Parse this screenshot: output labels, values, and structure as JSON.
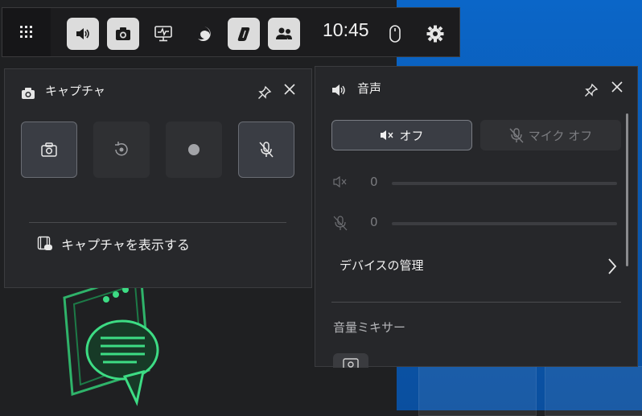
{
  "topbar": {
    "time": "10:45",
    "buttons": [
      {
        "name": "widget-menu-icon",
        "active": false
      },
      {
        "name": "audio-widget-icon",
        "active": true
      },
      {
        "name": "capture-widget-icon",
        "active": true
      },
      {
        "name": "performance-widget-icon",
        "active": false
      },
      {
        "name": "edge-icon",
        "active": false
      },
      {
        "name": "copilot-icon",
        "active": true
      },
      {
        "name": "xbox-social-icon",
        "active": true
      },
      {
        "name": "mouse-icon",
        "active": false
      },
      {
        "name": "settings-icon",
        "active": false
      }
    ]
  },
  "capture": {
    "title": "キャプチャ",
    "show_captures": "キャプチャを表示する",
    "buttons": [
      "screenshot-icon",
      "record-last-icon",
      "record-icon",
      "mic-off-icon"
    ]
  },
  "audio": {
    "title": "音声",
    "mute_label": "オフ",
    "mic_label": "マイク オフ",
    "output_value": "0",
    "mic_value": "0",
    "manage_devices": "デバイスの管理",
    "mixer_label": "音量ミキサー"
  },
  "colors": {
    "panel_bg": "#27282b",
    "desktop_blue": "#0b66c8",
    "accent_green": "#3ddc84"
  }
}
